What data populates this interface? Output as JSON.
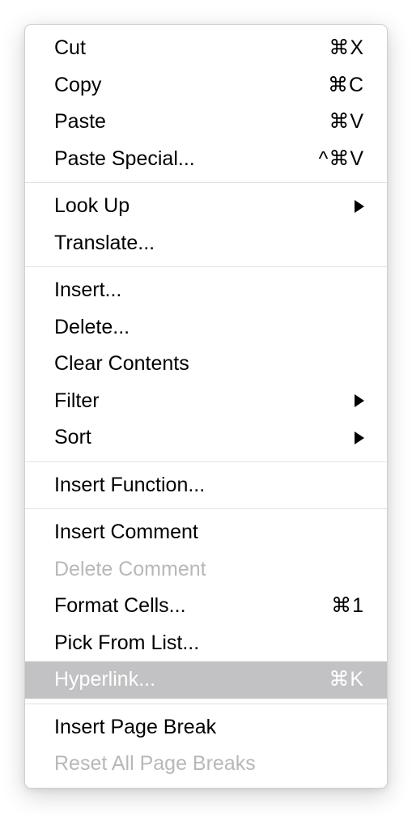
{
  "menu": {
    "groups": [
      [
        {
          "id": "cut",
          "label": "Cut",
          "shortcut": "⌘X",
          "disabled": false,
          "submenu": false,
          "highlighted": false
        },
        {
          "id": "copy",
          "label": "Copy",
          "shortcut": "⌘C",
          "disabled": false,
          "submenu": false,
          "highlighted": false
        },
        {
          "id": "paste",
          "label": "Paste",
          "shortcut": "⌘V",
          "disabled": false,
          "submenu": false,
          "highlighted": false
        },
        {
          "id": "paste-special",
          "label": "Paste Special...",
          "shortcut": "^⌘V",
          "disabled": false,
          "submenu": false,
          "highlighted": false
        }
      ],
      [
        {
          "id": "look-up",
          "label": "Look Up",
          "shortcut": "",
          "disabled": false,
          "submenu": true,
          "highlighted": false
        },
        {
          "id": "translate",
          "label": "Translate...",
          "shortcut": "",
          "disabled": false,
          "submenu": false,
          "highlighted": false
        }
      ],
      [
        {
          "id": "insert",
          "label": "Insert...",
          "shortcut": "",
          "disabled": false,
          "submenu": false,
          "highlighted": false
        },
        {
          "id": "delete",
          "label": "Delete...",
          "shortcut": "",
          "disabled": false,
          "submenu": false,
          "highlighted": false
        },
        {
          "id": "clear-contents",
          "label": "Clear Contents",
          "shortcut": "",
          "disabled": false,
          "submenu": false,
          "highlighted": false
        },
        {
          "id": "filter",
          "label": "Filter",
          "shortcut": "",
          "disabled": false,
          "submenu": true,
          "highlighted": false
        },
        {
          "id": "sort",
          "label": "Sort",
          "shortcut": "",
          "disabled": false,
          "submenu": true,
          "highlighted": false
        }
      ],
      [
        {
          "id": "insert-function",
          "label": "Insert Function...",
          "shortcut": "",
          "disabled": false,
          "submenu": false,
          "highlighted": false
        }
      ],
      [
        {
          "id": "insert-comment",
          "label": "Insert Comment",
          "shortcut": "",
          "disabled": false,
          "submenu": false,
          "highlighted": false
        },
        {
          "id": "delete-comment",
          "label": "Delete Comment",
          "shortcut": "",
          "disabled": true,
          "submenu": false,
          "highlighted": false
        },
        {
          "id": "format-cells",
          "label": "Format Cells...",
          "shortcut": "⌘1",
          "disabled": false,
          "submenu": false,
          "highlighted": false
        },
        {
          "id": "pick-from-list",
          "label": "Pick From List...",
          "shortcut": "",
          "disabled": false,
          "submenu": false,
          "highlighted": false
        },
        {
          "id": "hyperlink",
          "label": "Hyperlink...",
          "shortcut": "⌘K",
          "disabled": false,
          "submenu": false,
          "highlighted": true
        }
      ],
      [
        {
          "id": "insert-page-break",
          "label": "Insert Page Break",
          "shortcut": "",
          "disabled": false,
          "submenu": false,
          "highlighted": false
        },
        {
          "id": "reset-all-page-breaks",
          "label": "Reset All Page Breaks",
          "shortcut": "",
          "disabled": true,
          "submenu": false,
          "highlighted": false
        }
      ]
    ]
  }
}
